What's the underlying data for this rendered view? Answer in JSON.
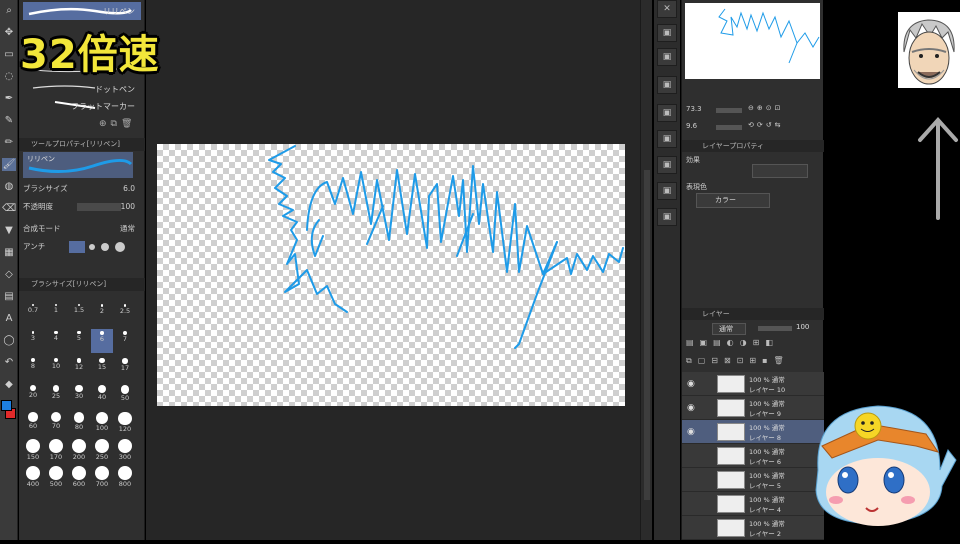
{
  "overlay": {
    "speed_label": "32倍速"
  },
  "tools": [
    "zoom-icon",
    "move-icon",
    "select-icon",
    "lasso-icon",
    "eyedropper-icon",
    "pen-icon",
    "pencil-icon",
    "brush-icon",
    "airbrush-icon",
    "eraser-icon",
    "fill-icon",
    "gradient-icon",
    "figure-icon",
    "frame-icon",
    "text-icon",
    "balloon-icon",
    "correct-icon",
    "color-icon"
  ],
  "brush_panel": {
    "brushes": [
      {
        "label": "リリペン",
        "selected": true
      },
      {
        "label": "",
        "selected": false
      },
      {
        "label": "ドットペン",
        "selected": false
      },
      {
        "label": "フラットマーカー",
        "selected": false
      }
    ],
    "tool_property_title": "ツールプロパティ[リリペン]",
    "tool_name": "リリペン",
    "properties": [
      {
        "label": "ブラシサイズ",
        "value": "6.0"
      },
      {
        "label": "不透明度",
        "value": "100"
      },
      {
        "label": "合成モード",
        "value": "通常"
      },
      {
        "label": "アンチ",
        "value": ""
      }
    ],
    "brush_size_title": "ブラシサイズ[リリペン]",
    "sizes": [
      "0.7",
      "1",
      "1.5",
      "2",
      "2.5",
      "3",
      "4",
      "5",
      "6",
      "7",
      "8",
      "10",
      "12",
      "15",
      "17",
      "20",
      "25",
      "30",
      "40",
      "50",
      "60",
      "70",
      "80",
      "100",
      "120",
      "150",
      "170",
      "200",
      "250",
      "300",
      "400",
      "500",
      "600",
      "700",
      "800"
    ],
    "selected_size": "6"
  },
  "right_panel": {
    "zoom_value": "73.3",
    "angle_value": "9.6",
    "layer_property_title": "レイヤープロパティ",
    "effect_label": "効果",
    "display_color_label": "表現色",
    "display_color_value": "カラー",
    "layer_title": "レイヤー",
    "blend_mode": "通常",
    "opacity": "100",
    "layers": [
      {
        "line1": "100 % 通常",
        "line2": "レイヤー 10",
        "visible": true,
        "selected": false
      },
      {
        "line1": "100 % 通常",
        "line2": "レイヤー 9",
        "visible": true,
        "selected": false
      },
      {
        "line1": "100 % 通常",
        "line2": "レイヤー 8",
        "visible": true,
        "selected": true
      },
      {
        "line1": "100 % 通常",
        "line2": "レイヤー 6",
        "visible": false,
        "selected": false
      },
      {
        "line1": "100 % 通常",
        "line2": "レイヤー 5",
        "visible": false,
        "selected": false
      },
      {
        "line1": "100 % 通常",
        "line2": "レイヤー 4",
        "visible": false,
        "selected": false
      },
      {
        "line1": "100 % 通常",
        "line2": "レイヤー 2",
        "visible": false,
        "selected": false
      }
    ]
  },
  "colors": {
    "stroke": "#1e9be8",
    "accent": "#566da0",
    "speed_label": "#f2e63a"
  }
}
